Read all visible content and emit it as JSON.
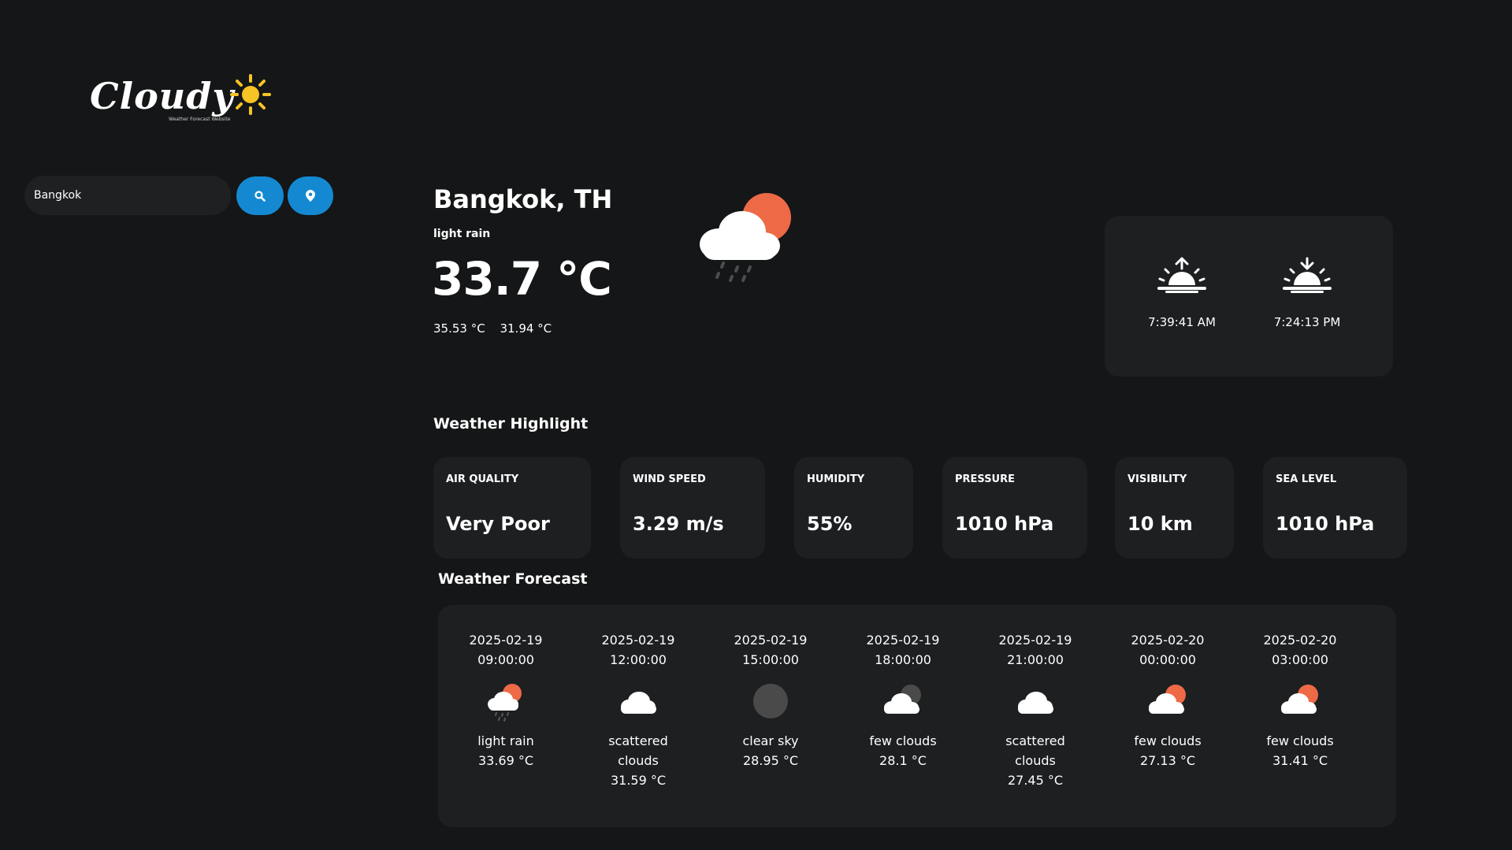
{
  "logo": {
    "name": "Cloudy",
    "tagline": "Weather Forecast Website"
  },
  "search": {
    "value": "Bangkok"
  },
  "current": {
    "city": "Bangkok, TH",
    "description": "light rain",
    "temperature": "33.7 °C",
    "temp_max": "35.53 °C",
    "temp_min": "31.94 °C",
    "icon": "light-rain-icon"
  },
  "sun": {
    "sunrise": "7:39:41 AM",
    "sunset": "7:24:13 PM"
  },
  "highlight": {
    "title": "Weather Highlight",
    "items": [
      {
        "label": "AIR QUALITY",
        "value": "Very Poor"
      },
      {
        "label": "WIND SPEED",
        "value": "3.29 m/s"
      },
      {
        "label": "HUMIDITY",
        "value": "55%"
      },
      {
        "label": "PRESSURE",
        "value": "1010 hPa"
      },
      {
        "label": "VISIBILITY",
        "value": "10 km"
      },
      {
        "label": "SEA LEVEL",
        "value": "1010 hPa"
      }
    ]
  },
  "forecast": {
    "title": "Weather Forecast",
    "items": [
      {
        "date": "2025-02-19",
        "time": "09:00:00",
        "desc": "light rain",
        "temp": "33.69 °C",
        "icon": "light-rain-icon"
      },
      {
        "date": "2025-02-19",
        "time": "12:00:00",
        "desc": "scattered clouds",
        "temp": "31.59 °C",
        "icon": "cloud-icon"
      },
      {
        "date": "2025-02-19",
        "time": "15:00:00",
        "desc": "clear sky",
        "temp": "28.95 °C",
        "icon": "moon-icon"
      },
      {
        "date": "2025-02-19",
        "time": "18:00:00",
        "desc": "few clouds",
        "temp": "28.1 °C",
        "icon": "cloud-night-icon"
      },
      {
        "date": "2025-02-19",
        "time": "21:00:00",
        "desc": "scattered clouds",
        "temp": "27.45 °C",
        "icon": "cloud-icon"
      },
      {
        "date": "2025-02-20",
        "time": "00:00:00",
        "desc": "few clouds",
        "temp": "27.13 °C",
        "icon": "cloud-sun-icon"
      },
      {
        "date": "2025-02-20",
        "time": "03:00:00",
        "desc": "few clouds",
        "temp": "31.41 °C",
        "icon": "cloud-sun-icon"
      }
    ]
  },
  "colors": {
    "accent": "#1489d1",
    "sun": "#ee6a47",
    "logo_sun": "#f7c325",
    "background": "#151617",
    "card": "#1d1f21"
  }
}
